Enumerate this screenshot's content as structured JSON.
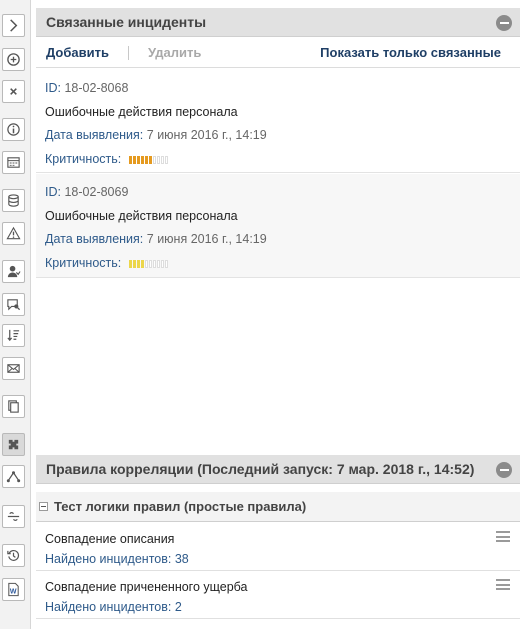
{
  "toolbar": {
    "icons": [
      "chevron-right-icon",
      "plus-circle-icon",
      "close-icon",
      "info-icon",
      "calendar-icon",
      "database-icon",
      "warning-icon",
      "user-icon",
      "chat-search-icon",
      "sort-icon",
      "mail-icon",
      "copy-icon",
      "puzzle-icon",
      "graph-icon",
      "link-icon",
      "history-icon",
      "word-document-icon"
    ]
  },
  "incidents_panel": {
    "title": "Связанные инциденты",
    "add_label": "Добавить",
    "delete_label": "Удалить",
    "show_only_label": "Показать только связанные",
    "items": [
      {
        "id_label": "ID:",
        "id": "18-02-8068",
        "name": "Ошибочные действия персонала",
        "date_label": "Дата выявления:",
        "date": "7 июня 2016 г., 14:19",
        "criticality_label": "Критичность:",
        "criticality_level": 0.6,
        "criticality_color": "#e59a1f"
      },
      {
        "id_label": "ID:",
        "id": "18-02-8069",
        "name": "Ошибочные действия персонала",
        "date_label": "Дата выявления:",
        "date": "7 июня 2016 г., 14:19",
        "criticality_label": "Критичность:",
        "criticality_level": 0.4,
        "criticality_color": "#ecd64a"
      }
    ]
  },
  "correlation_panel": {
    "title": "Правила корреляции (Последний запуск: 7 мар. 2018 г., 14:52)",
    "group_title": "Тест логики правил (простые правила)",
    "rules": [
      {
        "name": "Совпадение описания",
        "found": "Найдено инцидентов: 38"
      },
      {
        "name": "Совпадение причененного ущерба",
        "found": "Найдено инцидентов: 2"
      }
    ]
  }
}
